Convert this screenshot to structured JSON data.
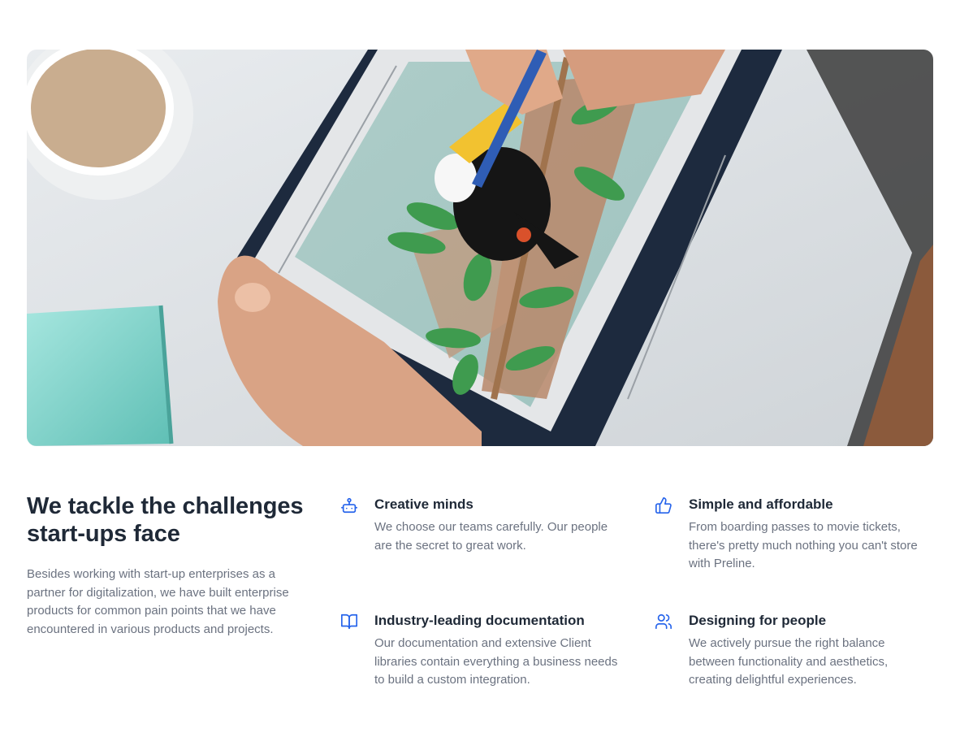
{
  "hero": {
    "icon": "photo-hands-drawing-toucan-on-tablet"
  },
  "intro": {
    "heading": "We tackle the challenges start-ups face",
    "description": "Besides working with start-up enterprises as a partner for digitalization, we have built enterprise products for common pain points that we have encountered in various products and projects."
  },
  "features": [
    {
      "icon": "bot-icon",
      "title": "Creative minds",
      "text": "We choose our teams carefully. Our people are the secret to great work."
    },
    {
      "icon": "thumbs-up-icon",
      "title": "Simple and affordable",
      "text": "From boarding passes to movie tickets, there's pretty much nothing you can't store with Preline."
    },
    {
      "icon": "book-open-icon",
      "title": "Industry-leading documentation",
      "text": "Our documentation and extensive Client libraries contain everything a business needs to build a custom integration."
    },
    {
      "icon": "users-icon",
      "title": "Designing for people",
      "text": "We actively pursue the right balance between functionality and aesthetics, creating delightful experiences."
    }
  ],
  "colors": {
    "accent": "#2563eb",
    "heading": "#1f2937",
    "muted": "#6b7280"
  }
}
